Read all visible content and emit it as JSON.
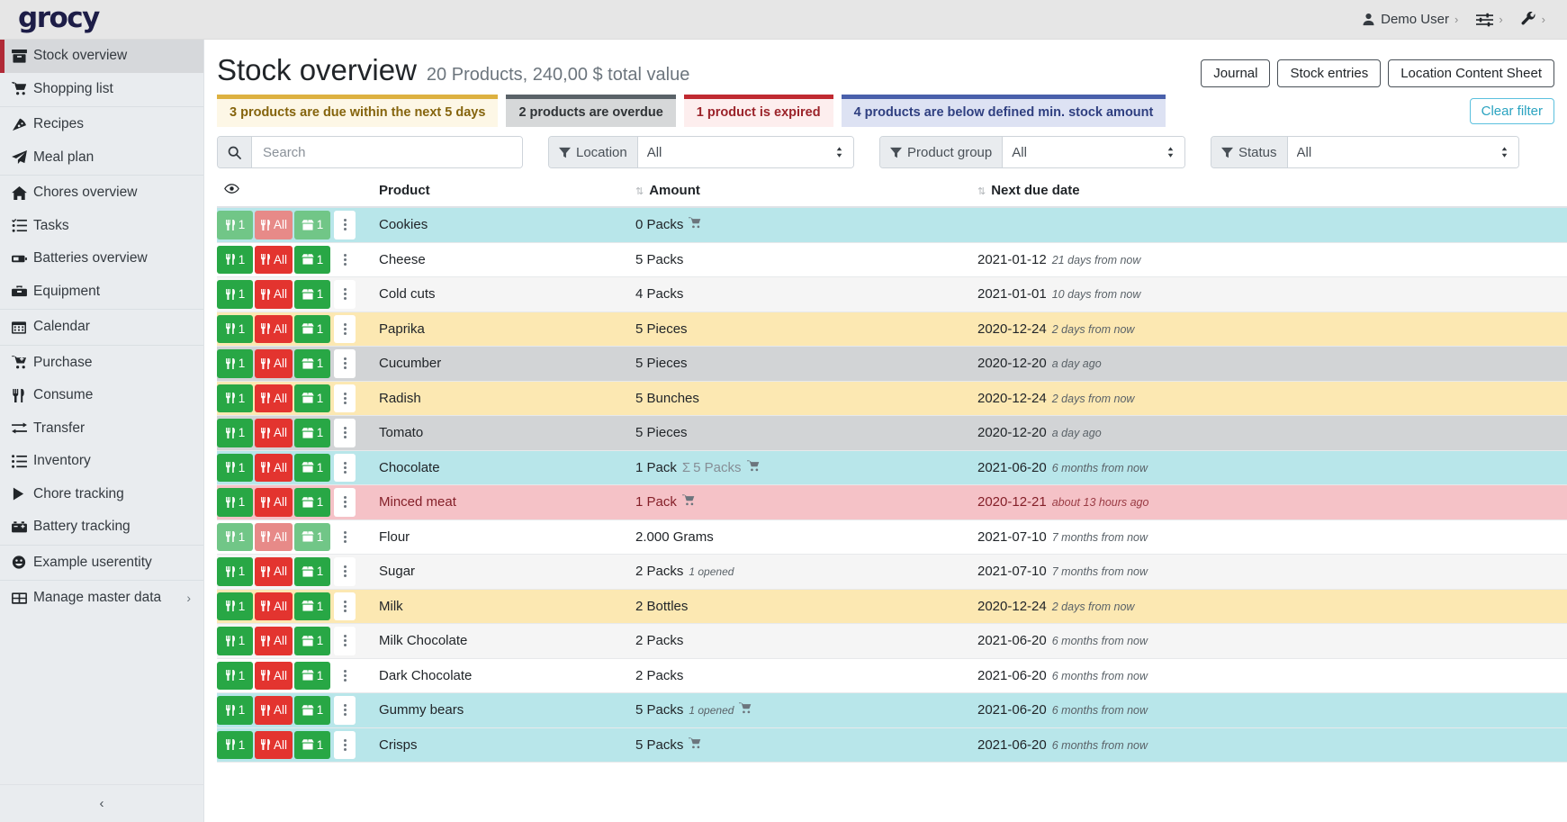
{
  "topbar": {
    "brand": "grocy",
    "user": {
      "label": "Demo User",
      "icon": "user-icon",
      "caret": "›"
    },
    "settings": {
      "label": "",
      "icon": "sliders-icon",
      "caret": "›"
    },
    "tools": {
      "label": "",
      "icon": "wrench-icon",
      "caret": "›"
    }
  },
  "sidebar": {
    "collapse_label": "‹",
    "items": [
      {
        "label": "Stock overview",
        "icon": "box-icon",
        "active": true,
        "group": 0
      },
      {
        "label": "Shopping list",
        "icon": "cart-icon",
        "active": false,
        "group": 0
      },
      {
        "label": "Recipes",
        "icon": "pizza-icon",
        "active": false,
        "group": 1
      },
      {
        "label": "Meal plan",
        "icon": "paper-plane-icon",
        "active": false,
        "group": 1
      },
      {
        "label": "Chores overview",
        "icon": "home-icon",
        "active": false,
        "group": 2
      },
      {
        "label": "Tasks",
        "icon": "tasks-icon",
        "active": false,
        "group": 2
      },
      {
        "label": "Batteries overview",
        "icon": "battery-icon",
        "active": false,
        "group": 2
      },
      {
        "label": "Equipment",
        "icon": "toolbox-icon",
        "active": false,
        "group": 2
      },
      {
        "label": "Calendar",
        "icon": "calendar-icon",
        "active": false,
        "group": 3
      },
      {
        "label": "Purchase",
        "icon": "cart-plus-icon",
        "active": false,
        "group": 4
      },
      {
        "label": "Consume",
        "icon": "utensils-icon",
        "active": false,
        "group": 4
      },
      {
        "label": "Transfer",
        "icon": "exchange-icon",
        "active": false,
        "group": 4
      },
      {
        "label": "Inventory",
        "icon": "list-icon",
        "active": false,
        "group": 4
      },
      {
        "label": "Chore tracking",
        "icon": "play-icon",
        "active": false,
        "group": 4
      },
      {
        "label": "Battery tracking",
        "icon": "car-battery-icon",
        "active": false,
        "group": 4
      },
      {
        "label": "Example userentity",
        "icon": "smile-icon",
        "active": false,
        "group": 5
      },
      {
        "label": "Manage master data",
        "icon": "table-icon",
        "active": false,
        "group": 6,
        "chevron": "›"
      }
    ]
  },
  "page": {
    "title": "Stock overview",
    "subtitle": "20 Products, 240,00 $ total value",
    "buttons": [
      {
        "label": "Journal",
        "name": "journal-button"
      },
      {
        "label": "Stock entries",
        "name": "stock-entries-button"
      },
      {
        "label": "Location Content Sheet",
        "name": "location-content-sheet-button"
      }
    ]
  },
  "status_chips": [
    {
      "label": "3 products are due within the next 5 days",
      "bar": "#ddb140",
      "bg": "#fdf7e6",
      "fg": "#85640d",
      "name": "due-soon-chip"
    },
    {
      "label": "2 products are overdue",
      "bar": "#5a6268",
      "bg": "#d6d8d9",
      "fg": "#2f3336",
      "name": "overdue-chip"
    },
    {
      "label": "1 product is expired",
      "bar": "#c02a31",
      "bg": "#fdeeee",
      "fg": "#9b232a",
      "name": "expired-chip"
    },
    {
      "label": "4 products are below defined min. stock amount",
      "bar": "#4960ab",
      "bg": "#dde2f3",
      "fg": "#2f3f80",
      "name": "below-min-chip"
    }
  ],
  "clear_filter": {
    "label": "Clear filter"
  },
  "filters": {
    "search": {
      "placeholder": "Search",
      "value": "",
      "icon": "search-icon"
    },
    "location": {
      "label": "Location",
      "value": "All",
      "icon": "filter-icon",
      "options": [
        "All"
      ]
    },
    "product_group": {
      "label": "Product group",
      "value": "All",
      "icon": "filter-icon",
      "options": [
        "All"
      ]
    },
    "status": {
      "label": "Status",
      "value": "All",
      "icon": "filter-icon",
      "options": [
        "All"
      ]
    }
  },
  "table": {
    "headers": {
      "eye": "",
      "product": "Product",
      "amount": "Amount",
      "due": "Next due date",
      "sort_glyph": "⇅"
    },
    "row_buttons": {
      "consume_one": "1",
      "consume_all": "All",
      "open_one": "1",
      "consume_one_icon": "utensils-icon",
      "consume_all_icon": "utensils-icon",
      "open_icon": "box-open-icon",
      "menu_icon": "kebab-menu-icon"
    },
    "rows": [
      {
        "product": "Cookies",
        "amount": "0 Packs",
        "sum": "",
        "opened": "",
        "cart": true,
        "date": "",
        "rel": "",
        "style": "r-blue",
        "faded": true
      },
      {
        "product": "Cheese",
        "amount": "5 Packs",
        "sum": "",
        "opened": "",
        "cart": false,
        "date": "2021-01-12",
        "rel": "21 days from now",
        "style": "r-white",
        "faded": false
      },
      {
        "product": "Cold cuts",
        "amount": "4 Packs",
        "sum": "",
        "opened": "",
        "cart": false,
        "date": "2021-01-01",
        "rel": "10 days from now",
        "style": "r-striped",
        "faded": false
      },
      {
        "product": "Paprika",
        "amount": "5 Pieces",
        "sum": "",
        "opened": "",
        "cart": false,
        "date": "2020-12-24",
        "rel": "2 days from now",
        "style": "r-yellow",
        "faded": false
      },
      {
        "product": "Cucumber",
        "amount": "5 Pieces",
        "sum": "",
        "opened": "",
        "cart": false,
        "date": "2020-12-20",
        "rel": "a day ago",
        "style": "r-gray",
        "faded": false
      },
      {
        "product": "Radish",
        "amount": "5 Bunches",
        "sum": "",
        "opened": "",
        "cart": false,
        "date": "2020-12-24",
        "rel": "2 days from now",
        "style": "r-yellow",
        "faded": false
      },
      {
        "product": "Tomato",
        "amount": "5 Pieces",
        "sum": "",
        "opened": "",
        "cart": false,
        "date": "2020-12-20",
        "rel": "a day ago",
        "style": "r-gray",
        "faded": false
      },
      {
        "product": "Chocolate",
        "amount": "1 Pack",
        "sum": "5 Packs",
        "opened": "",
        "cart": true,
        "date": "2021-06-20",
        "rel": "6 months from now",
        "style": "r-blue",
        "faded": false
      },
      {
        "product": "Minced meat",
        "amount": "1 Pack",
        "sum": "",
        "opened": "",
        "cart": true,
        "date": "2020-12-21",
        "rel": "about 13 hours ago",
        "style": "r-red",
        "faded": false
      },
      {
        "product": "Flour",
        "amount": "2.000 Grams",
        "sum": "",
        "opened": "",
        "cart": false,
        "date": "2021-07-10",
        "rel": "7 months from now",
        "style": "r-white",
        "faded": true
      },
      {
        "product": "Sugar",
        "amount": "2 Packs",
        "sum": "",
        "opened": "1 opened",
        "cart": false,
        "date": "2021-07-10",
        "rel": "7 months from now",
        "style": "r-striped",
        "faded": false
      },
      {
        "product": "Milk",
        "amount": "2 Bottles",
        "sum": "",
        "opened": "",
        "cart": false,
        "date": "2020-12-24",
        "rel": "2 days from now",
        "style": "r-yellow",
        "faded": false
      },
      {
        "product": "Milk Chocolate",
        "amount": "2 Packs",
        "sum": "",
        "opened": "",
        "cart": false,
        "date": "2021-06-20",
        "rel": "6 months from now",
        "style": "r-striped",
        "faded": false
      },
      {
        "product": "Dark Chocolate",
        "amount": "2 Packs",
        "sum": "",
        "opened": "",
        "cart": false,
        "date": "2021-06-20",
        "rel": "6 months from now",
        "style": "r-white",
        "faded": false
      },
      {
        "product": "Gummy bears",
        "amount": "5 Packs",
        "sum": "",
        "opened": "1 opened",
        "cart": true,
        "date": "2021-06-20",
        "rel": "6 months from now",
        "style": "r-blue",
        "faded": false
      },
      {
        "product": "Crisps",
        "amount": "5 Packs",
        "sum": "",
        "opened": "",
        "cart": true,
        "date": "2021-06-20",
        "rel": "6 months from now",
        "style": "r-blue",
        "faded": false
      },
      {
        "product": "",
        "amount": "",
        "sum": "",
        "opened": "",
        "cart": false,
        "date": "",
        "rel": "",
        "style": "r-white",
        "faded": false
      }
    ]
  }
}
